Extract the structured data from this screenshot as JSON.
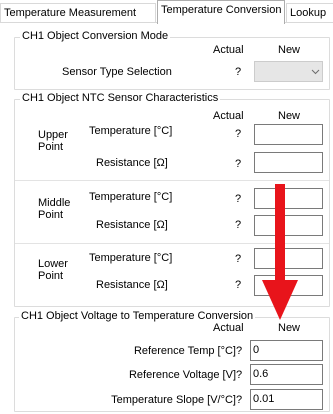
{
  "tabs": [
    {
      "label": "Temperature Measurement",
      "active": false
    },
    {
      "label": "Temperature Conversion",
      "active": true
    },
    {
      "label": "Lookup",
      "active": false
    }
  ],
  "mode_group": {
    "title": "CH1 Object Conversion Mode",
    "col_actual": "Actual",
    "col_new": "New",
    "sensor_type_label": "Sensor Type Selection",
    "sensor_type_actual": "?",
    "sensor_type_new": "",
    "chevron_icon": "chevron-down-icon"
  },
  "ntc_group": {
    "title": "CH1 Object NTC Sensor Characteristics",
    "col_actual": "Actual",
    "col_new": "New",
    "points": [
      {
        "label": "Upper Point",
        "temp_label": "Temperature [°C]",
        "temp_actual": "?",
        "temp_new": "",
        "res_label": "Resistance [Ω]",
        "res_actual": "?",
        "res_new": ""
      },
      {
        "label": "Middle Point",
        "temp_label": "Temperature [°C]",
        "temp_actual": "?",
        "temp_new": "",
        "res_label": "Resistance [Ω]",
        "res_actual": "?",
        "res_new": ""
      },
      {
        "label": "Lower Point",
        "temp_label": "Temperature [°C]",
        "temp_actual": "?",
        "temp_new": "",
        "res_label": "Resistance [Ω]",
        "res_actual": "?",
        "res_new": ""
      }
    ]
  },
  "voltage_group": {
    "title": "CH1 Object Voltage to Temperature Conversion",
    "col_actual": "Actual",
    "col_new": "New",
    "rows": [
      {
        "label": "Reference Temp [°C]",
        "actual": "?",
        "new": "0"
      },
      {
        "label": "Reference Voltage [V]",
        "actual": "?",
        "new": "0.6"
      },
      {
        "label": "Temperature Slope [V/°C]",
        "actual": "?",
        "new": "0.01"
      }
    ]
  },
  "annotation": {
    "icon": "red-arrow-down-icon",
    "color": "#e8141b"
  }
}
